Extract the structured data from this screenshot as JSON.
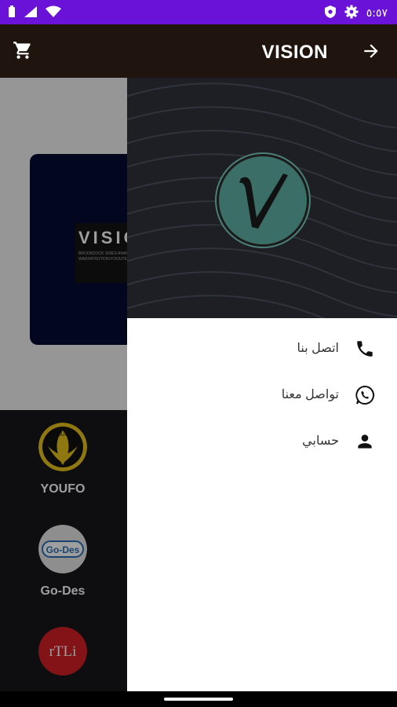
{
  "status_bar": {
    "time": "٥:٥٧",
    "icons": [
      "battery-icon",
      "signal-icon",
      "wifi-icon",
      "shield-icon",
      "settings-icon"
    ]
  },
  "app_bar": {
    "title": "VISION",
    "icons": [
      "cart-icon",
      "arrow-forward-icon"
    ],
    "background_color": "#1f140e"
  },
  "banner": {
    "brand_text": "VISIO",
    "fine_print": "BROOKDOCK SRIES ANAHRA ALMAFAHA ALMAFAHA WARFATROTION FOOUTE CODE CHAR"
  },
  "stores": [
    {
      "name": "YOUFO",
      "logo_text": "YOUFO"
    },
    {
      "name": "Go-Des",
      "logo_text": "Go-Des"
    },
    {
      "name": "",
      "logo_text": "rTLi"
    }
  ],
  "drawer": {
    "header_logo": "V",
    "items": [
      {
        "label": "اتصل بنا",
        "icon": "phone-icon"
      },
      {
        "label": "تواصل معنا",
        "icon": "whatsapp-icon"
      },
      {
        "label": "حسابي",
        "icon": "person-icon"
      }
    ]
  }
}
